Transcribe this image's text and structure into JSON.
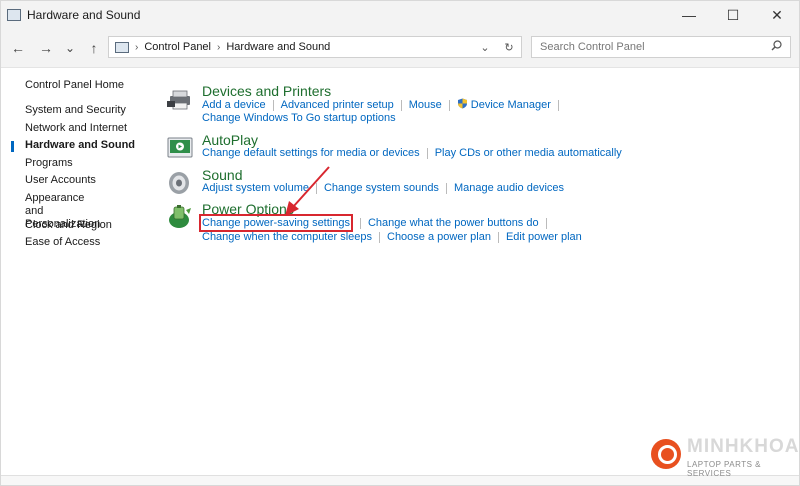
{
  "window": {
    "title": "Hardware and Sound",
    "minimize": "—",
    "maximize": "☐",
    "close": "✕"
  },
  "nav": {
    "back": "←",
    "forward": "→",
    "recent": "⌄",
    "up": "↑"
  },
  "breadcrumb": [
    "Control Panel",
    "Hardware and Sound"
  ],
  "address_controls": {
    "dropdown": "⌄",
    "refresh": "↻"
  },
  "search": {
    "placeholder": "Search Control Panel",
    "icon": "search-icon"
  },
  "sidebar": {
    "items": [
      {
        "label": "Control Panel Home",
        "active": false
      },
      {
        "label": "System and Security",
        "active": false
      },
      {
        "label": "Network and Internet",
        "active": false
      },
      {
        "label": "Hardware and Sound",
        "active": true
      },
      {
        "label": "Programs",
        "active": false
      },
      {
        "label": "User Accounts",
        "active": false
      },
      {
        "label": "Appearance and Personalization",
        "active": false
      },
      {
        "label": "Clock and Region",
        "active": false
      },
      {
        "label": "Ease of Access",
        "active": false
      }
    ]
  },
  "categories": [
    {
      "title": "Devices and Printers",
      "icon": "printer-icon",
      "lines": [
        [
          "Add a device",
          "Advanced printer setup",
          "Mouse",
          "Device Manager"
        ],
        [
          "Change Windows To Go startup options"
        ]
      ]
    },
    {
      "title": "AutoPlay",
      "icon": "autoplay-icon",
      "lines": [
        [
          "Change default settings for media or devices",
          "Play CDs or other media automatically"
        ]
      ]
    },
    {
      "title": "Sound",
      "icon": "speaker-icon",
      "lines": [
        [
          "Adjust system volume",
          "Change system sounds",
          "Manage audio devices"
        ]
      ]
    },
    {
      "title": "Power Options",
      "icon": "battery-icon",
      "lines": [
        [
          "Change power-saving settings",
          "Change what the power buttons do"
        ],
        [
          "Change when the computer sleeps",
          "Choose a power plan",
          "Edit power plan"
        ]
      ]
    }
  ],
  "highlighted_link": "Change power-saving settings",
  "annotation_color": "#d8272f",
  "accent_color": "#0067c0",
  "category_title_color": "#1e6e2e",
  "watermark": {
    "brand": "MINHKHOA",
    "tagline": "LAPTOP PARTS & SERVICES",
    "color": "#e8501f"
  }
}
